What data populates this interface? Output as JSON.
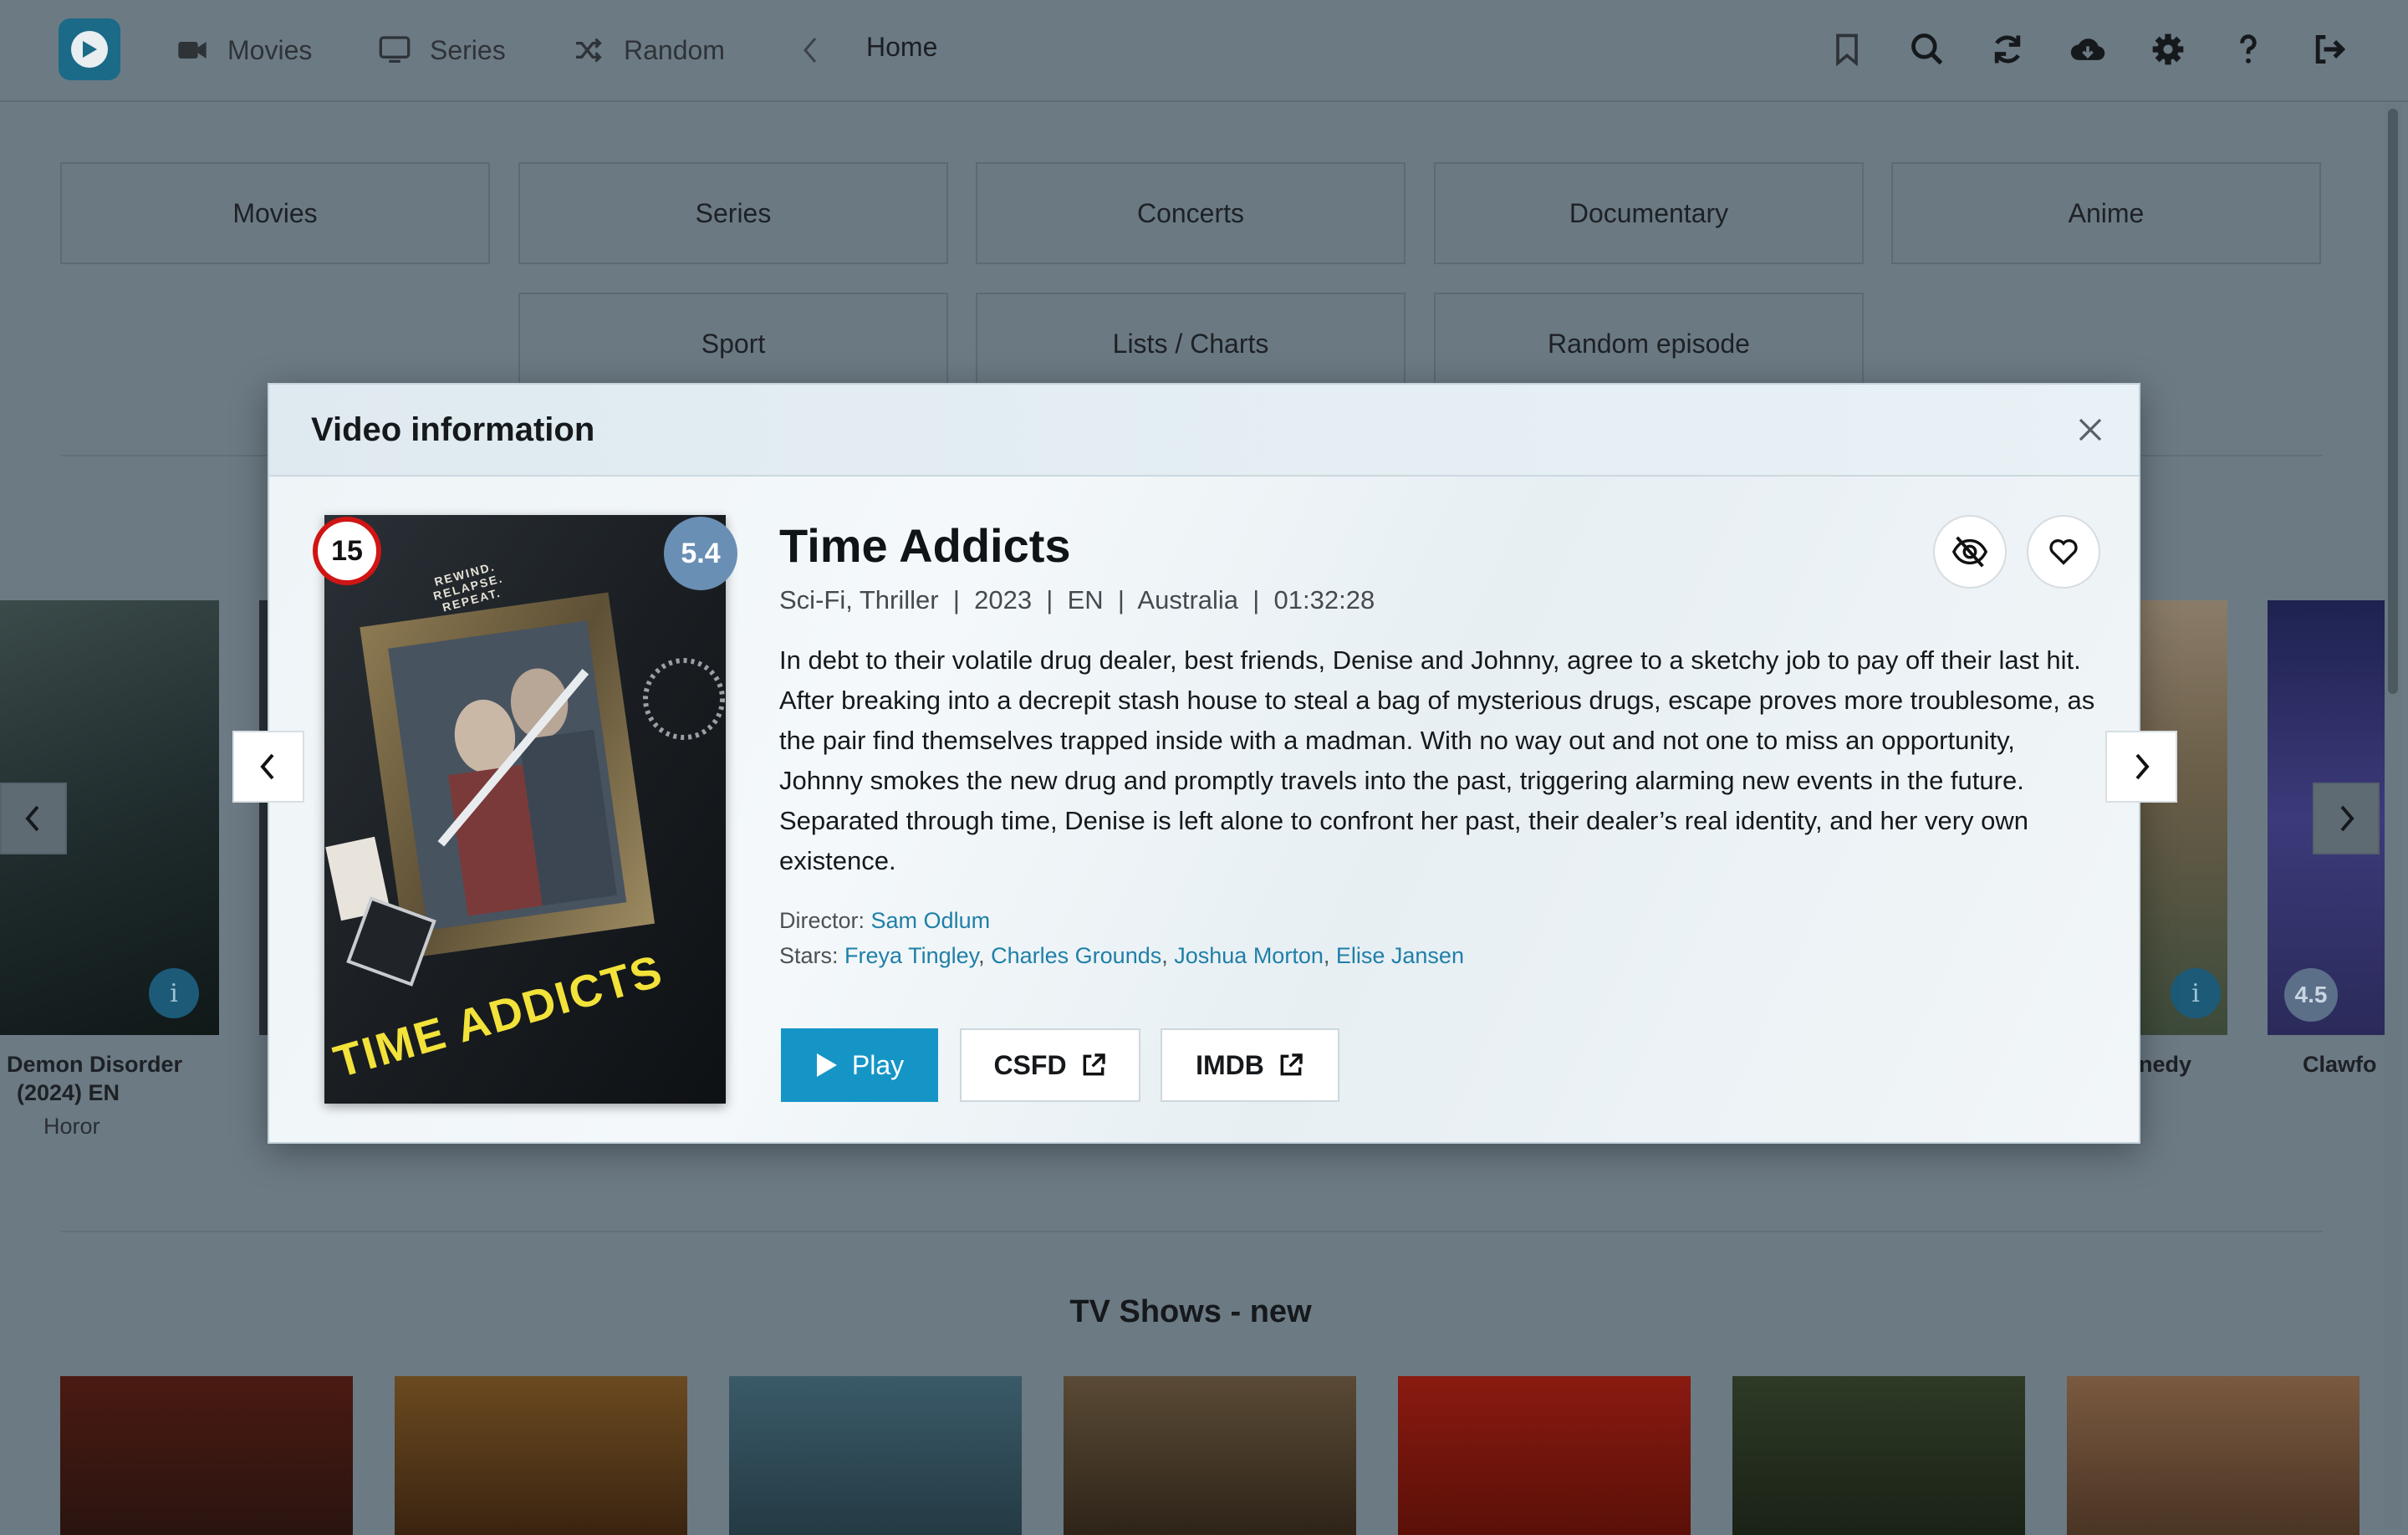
{
  "nav": {
    "movies": "Movies",
    "series": "Series",
    "random": "Random",
    "breadcrumb": "Home"
  },
  "categories": [
    "Movies",
    "Series",
    "Concerts",
    "Documentary",
    "Anime",
    "Sport",
    "Lists / Charts",
    "Random episode"
  ],
  "carousel": {
    "left_title_1": "Demon Disorder",
    "left_title_2": "(2024) EN",
    "left_genre": "Horor",
    "right_title_1": "nedy",
    "right_title_2": "Clawfo",
    "right_score": "4.5",
    "info_label": "i"
  },
  "section": {
    "tv_new": "TV Shows - new"
  },
  "modal": {
    "title": "Video information",
    "movie_title": "Time Addicts",
    "meta": "Sci-Fi, Thriller  |  2023  |  EN  |  Australia  |  01:32:28",
    "description": "In debt to their volatile drug dealer, best friends, Denise and Johnny, agree to a sketchy job to pay off their last hit. After breaking into a decrepit stash house to steal a bag of mysterious drugs, escape proves more troublesome, as the pair find themselves trapped inside with a madman. With no way out and not one to miss an opportunity, Johnny smokes the new drug and promptly travels into the past, triggering alarming new events in the future. Separated through time, Denise is left alone to confront her past, their dealer’s real identity, and her very own existence.",
    "director_label": "Director:",
    "director": "Sam Odlum",
    "stars_label": "Stars:",
    "stars": [
      "Freya Tingley",
      "Charles Grounds",
      "Joshua Morton",
      "Elise Jansen"
    ],
    "age_rating": "15",
    "score": "5.4",
    "play": "Play",
    "csfd": "CSFD",
    "imdb": "IMDB",
    "poster_tagline": "REWIND. RELAPSE. REPEAT.",
    "poster_title": "TIME ADDICTS"
  },
  "colors": {
    "accent": "#1595c6",
    "link": "#1f7fa8",
    "age_border": "#d01515",
    "score_bg": "#6a8fb4"
  }
}
